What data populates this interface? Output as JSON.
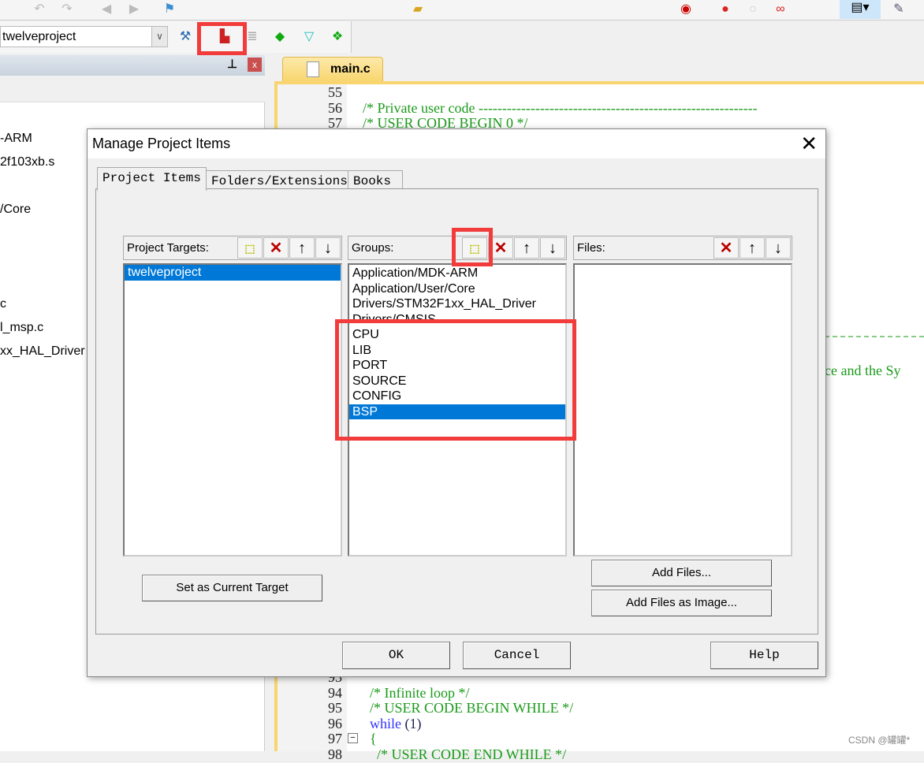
{
  "toolbar": {
    "target_combo": "twelveproject"
  },
  "project_panel": {
    "tree_items": [
      "-ARM",
      "2f103xb.s",
      "/Core",
      "c",
      "l_msp.c",
      "xx_HAL_Driver"
    ]
  },
  "editor": {
    "tab": "main.c",
    "lines_top": [
      {
        "n": "55",
        "t": ""
      },
      {
        "n": "56",
        "t": "/* Private user code -----------------------------------------------------------"
      },
      {
        "n": "57",
        "t": "/* USER CODE BEGIN 0 */"
      }
    ],
    "partial_line": "ce and the Sy",
    "lines_bottom": [
      {
        "n": "93",
        "t": ""
      },
      {
        "n": "94",
        "t": "  /* Infinite loop */"
      },
      {
        "n": "95",
        "t": "  /* USER CODE BEGIN WHILE */"
      },
      {
        "n": "96",
        "kw": "  while",
        "t": " (1)"
      },
      {
        "n": "97",
        "t": "  {"
      },
      {
        "n": "98",
        "t": "    /* USER CODE END WHILE */"
      }
    ]
  },
  "dialog": {
    "title": "Manage Project Items",
    "tabs": [
      "Project Items",
      "Folders/Extensions",
      "Books"
    ],
    "targets": {
      "label": "Project Targets:",
      "items": [
        "twelveproject"
      ],
      "selected": 0
    },
    "groups": {
      "label": "Groups:",
      "items": [
        "Application/MDK-ARM",
        "Application/User/Core",
        "Drivers/STM32F1xx_HAL_Driver",
        "Drivers/CMSIS",
        "CPU",
        "LIB",
        "PORT",
        "SOURCE",
        "CONFIG",
        "BSP"
      ],
      "selected": 9
    },
    "files": {
      "label": "Files:",
      "items": []
    },
    "set_current": "Set as Current Target",
    "add_files": "Add Files...",
    "add_image": "Add Files as Image...",
    "ok": "OK",
    "cancel": "Cancel",
    "help": "Help"
  },
  "watermark": "CSDN @罐罐*",
  "colors": {
    "highlight": "#f23c3c",
    "selection": "#0078d7",
    "comment": "#1a9a1a",
    "keyword": "#3030ff"
  }
}
